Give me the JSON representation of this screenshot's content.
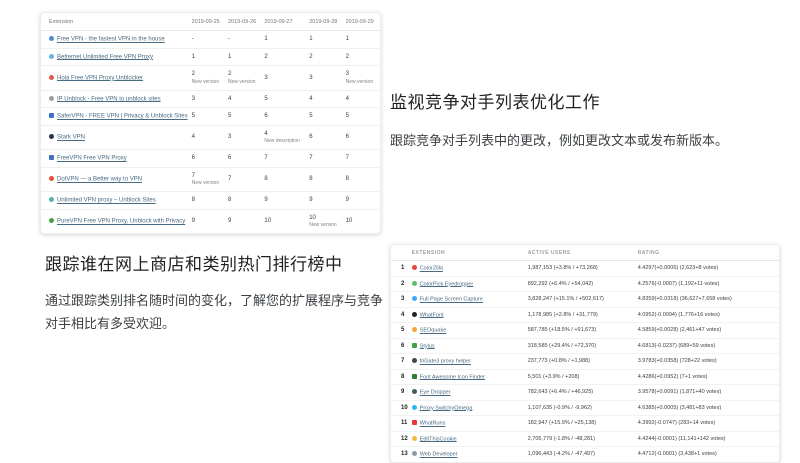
{
  "rank_table": {
    "columns": [
      "Extension",
      "2019-09-25",
      "2019-09-26",
      "2019-09-27",
      "2019-09-28",
      "2019-09-29"
    ],
    "rows": [
      {
        "name": "Free VPN - the fastest VPN in the house",
        "icon": "globe-icon",
        "color": "#4a8fd3",
        "shape": "circle",
        "cells": [
          {
            "v": "-"
          },
          {
            "v": "-"
          },
          {
            "v": "1"
          },
          {
            "v": "1"
          },
          {
            "v": "1"
          }
        ]
      },
      {
        "name": "Betternet Unlimited Free VPN Proxy",
        "icon": "betternet-icon",
        "color": "#64b5e0",
        "shape": "circle",
        "cells": [
          {
            "v": "1"
          },
          {
            "v": "1"
          },
          {
            "v": "2"
          },
          {
            "v": "2"
          },
          {
            "v": "2"
          }
        ]
      },
      {
        "name": "Hola Free VPN Proxy Unblocker",
        "icon": "hola-icon",
        "color": "#e2574c",
        "shape": "circle",
        "cells": [
          {
            "v": "2",
            "note": "New version"
          },
          {
            "v": "2",
            "note": "New version"
          },
          {
            "v": "3"
          },
          {
            "v": "3"
          },
          {
            "v": "3",
            "note": "New version"
          }
        ]
      },
      {
        "name": "IP Unblock - Free VPN to unblock sites",
        "icon": "ip-unblock-icon",
        "color": "#9e9e9e",
        "shape": "circle",
        "cells": [
          {
            "v": "3"
          },
          {
            "v": "4"
          },
          {
            "v": "5"
          },
          {
            "v": "4"
          },
          {
            "v": "4"
          }
        ]
      },
      {
        "name": "SaferVPN - FREE VPN | Privacy & Unblock Sites",
        "icon": "safervpn-icon",
        "color": "#3d6fd0",
        "shape": "square",
        "cells": [
          {
            "v": "5"
          },
          {
            "v": "5"
          },
          {
            "v": "6"
          },
          {
            "v": "5"
          },
          {
            "v": "5"
          }
        ]
      },
      {
        "name": "Stark VPN",
        "icon": "starkvpn-icon",
        "color": "#263445",
        "shape": "circle",
        "cells": [
          {
            "v": "4"
          },
          {
            "v": "3"
          },
          {
            "v": "4",
            "note": "New description"
          },
          {
            "v": "6"
          },
          {
            "v": "6"
          }
        ]
      },
      {
        "name": "FreeVPN Free VPN Proxy",
        "icon": "freevpn-icon",
        "color": "#3f6fbf",
        "shape": "square",
        "cells": [
          {
            "v": "6"
          },
          {
            "v": "6"
          },
          {
            "v": "7"
          },
          {
            "v": "7"
          },
          {
            "v": "7"
          }
        ]
      },
      {
        "name": "DotVPN — a Better way to VPN",
        "icon": "dotvpn-icon",
        "color": "#e0503c",
        "shape": "circle",
        "cells": [
          {
            "v": "7",
            "note": "New version"
          },
          {
            "v": "7"
          },
          {
            "v": "8"
          },
          {
            "v": "8"
          },
          {
            "v": "8"
          }
        ]
      },
      {
        "name": "Unlimited VPN proxy – Unblock Sites",
        "icon": "unlimited-vpn-icon",
        "color": "#4db6ac",
        "shape": "circle",
        "cells": [
          {
            "v": "8"
          },
          {
            "v": "8"
          },
          {
            "v": "9"
          },
          {
            "v": "9"
          },
          {
            "v": "9"
          }
        ]
      },
      {
        "name": "PureVPN Free VPN Proxy, Unblock with Privacy",
        "icon": "purevpn-icon",
        "color": "#43a047",
        "shape": "circle",
        "cells": [
          {
            "v": "9"
          },
          {
            "v": "9"
          },
          {
            "v": "10"
          },
          {
            "v": "10",
            "note": "New version"
          },
          {
            "v": "10"
          }
        ]
      }
    ]
  },
  "feature_monitor": {
    "title": "监视竞争对手列表优化工作",
    "body": "跟踪竞争对手列表中的更改，例如更改文本或发布新版本。"
  },
  "feature_rank": {
    "title": "跟踪谁在网上商店和类别热门排行榜中",
    "body": "通过跟踪类别排名随时间的变化，了解您的扩展程序与竞争对手相比有多受欢迎。"
  },
  "stats_table": {
    "columns": [
      "Extension",
      "Active users",
      "Rating"
    ],
    "rows": [
      {
        "rank": "1",
        "name": "ColorZilla",
        "icon": "colorzilla-icon",
        "color": "#e8453c",
        "shape": "circle",
        "users": "1,987,153 (+3.8% / +73,268)",
        "rating": "4.4297(+0.0006) (2,623+8 votes)"
      },
      {
        "rank": "2",
        "name": "ColorPick Eyedropper",
        "icon": "colorpick-icon",
        "color": "#66bb6a",
        "shape": "circle",
        "users": "892,292 (+6.4% / +54,042)",
        "rating": "4.2576(-0.0007) (1,192+11 votes)"
      },
      {
        "rank": "3",
        "name": "Full Page Screen Capture",
        "icon": "camera-icon",
        "color": "#42a5f5",
        "shape": "circle",
        "users": "3,828,247 (+15.1% / +502,617)",
        "rating": "4.8359(+0.0318) (36,627+7,658 votes)"
      },
      {
        "rank": "4",
        "name": "WhatFont",
        "icon": "whatfont-icon",
        "color": "#212121",
        "shape": "circle",
        "users": "1,178,985 (+2.8% / +31,779)",
        "rating": "4.0952(-0.0094) (1,776+16 votes)"
      },
      {
        "rank": "5",
        "name": "SEOquake",
        "icon": "seoquake-icon",
        "color": "#f2a33c",
        "shape": "circle",
        "users": "587,785 (+18.5% / +91,673)",
        "rating": "4.5859(+0.0028) (2,461+47 votes)"
      },
      {
        "rank": "6",
        "name": "Stylus",
        "icon": "stylus-icon",
        "color": "#43a047",
        "shape": "square",
        "users": "318,585 (+29.4% / +72,370)",
        "rating": "4.6813(-0.0237) (689+59 votes)"
      },
      {
        "rank": "7",
        "name": "friGate3 proxy helper",
        "icon": "frigate-icon",
        "color": "#37474f",
        "shape": "circle",
        "users": "237,773 (+0.8% / +1,988)",
        "rating": "3.9783(+0.0358) (728+22 votes)"
      },
      {
        "rank": "8",
        "name": "Font Awesome Icon Finder",
        "icon": "flag-icon",
        "color": "#2e7d32",
        "shape": "square",
        "users": "5,501 (+3.9% / +208)",
        "rating": "4.4286(+0.0952) (7+1 votes)"
      },
      {
        "rank": "9",
        "name": "Eye Dropper",
        "icon": "eyedropper-icon",
        "color": "#455a64",
        "shape": "circle",
        "users": "782,643 (+6.4% / +46,925)",
        "rating": "3.9578(+0.0091) (1,871+40 votes)"
      },
      {
        "rank": "10",
        "name": "Proxy SwitchyOmega",
        "icon": "switchyomega-icon",
        "color": "#29b6f6",
        "shape": "circle",
        "users": "1,107,635 (-0.9% / -9,962)",
        "rating": "4.6385(+0.0005) (3,481+83 votes)"
      },
      {
        "rank": "11",
        "name": "WhatRuns",
        "icon": "whatruns-icon",
        "color": "#e53935",
        "shape": "square",
        "users": "182,947 (+15.9% / +25,138)",
        "rating": "4.3992(-0.0747) (283+14 votes)"
      },
      {
        "rank": "12",
        "name": "EditThisCookie",
        "icon": "cookie-icon",
        "color": "#f6b93b",
        "shape": "circle",
        "users": "2,705,779 (-1.8% / -48,281)",
        "rating": "4.4244(-0.0001) (11,141+142 votes)"
      },
      {
        "rank": "13",
        "name": "Web Developer",
        "icon": "gear-icon",
        "color": "#8d9aa5",
        "shape": "circle",
        "users": "1,096,443 (-4.2% / -47,497)",
        "rating": "4.4712(-0.0001) (3,438+1 votes)"
      }
    ]
  }
}
